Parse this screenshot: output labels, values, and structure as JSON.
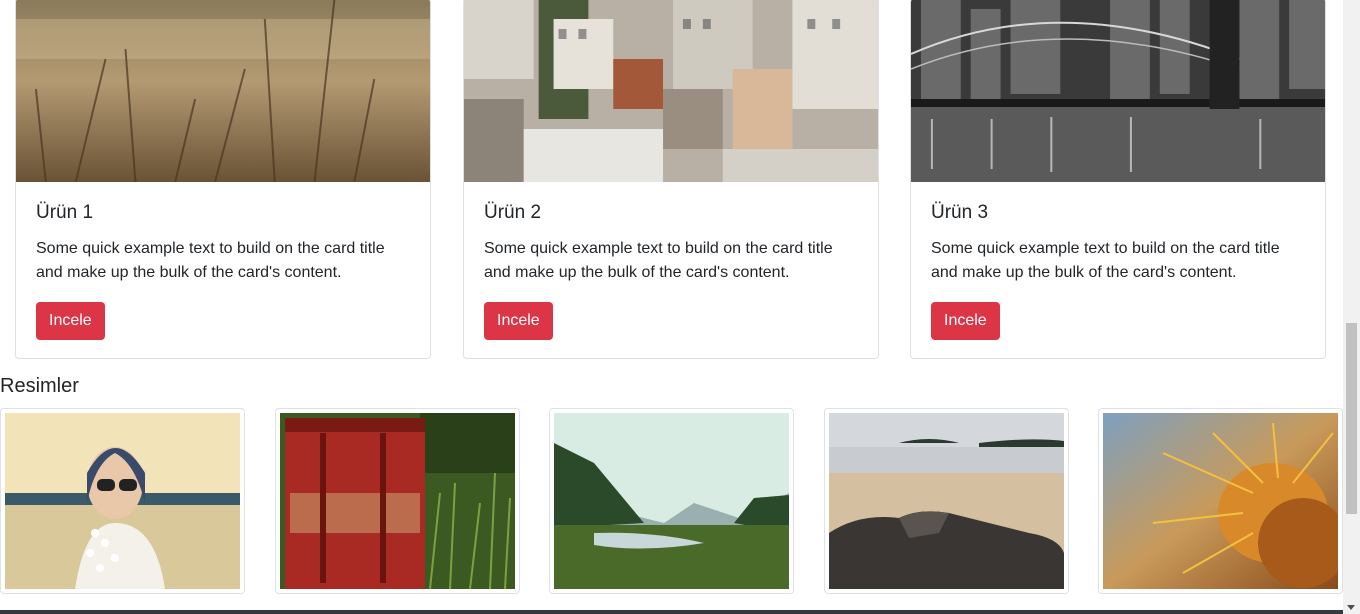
{
  "cards": [
    {
      "title": "Ürün 1",
      "text": "Some quick example text to build on the card title and make up the bulk of the card's content.",
      "button": "Incele",
      "image": "wheat-field-image"
    },
    {
      "title": "Ürün 2",
      "text": "Some quick example text to build on the card title and make up the bulk of the card's content.",
      "button": "Incele",
      "image": "city-rooftops-image"
    },
    {
      "title": "Ürün 3",
      "text": "Some quick example text to build on the card title and make up the bulk of the card's content.",
      "button": "Incele",
      "image": "bridge-skyline-image"
    }
  ],
  "gallery": {
    "heading": "Resimler",
    "images": [
      "woman-flowers-image",
      "red-barrel-image",
      "mountain-valley-image",
      "beach-rocks-image",
      "cactus-closeup-image"
    ]
  },
  "colors": {
    "button": "#dc3545",
    "footer": "#343a40"
  }
}
